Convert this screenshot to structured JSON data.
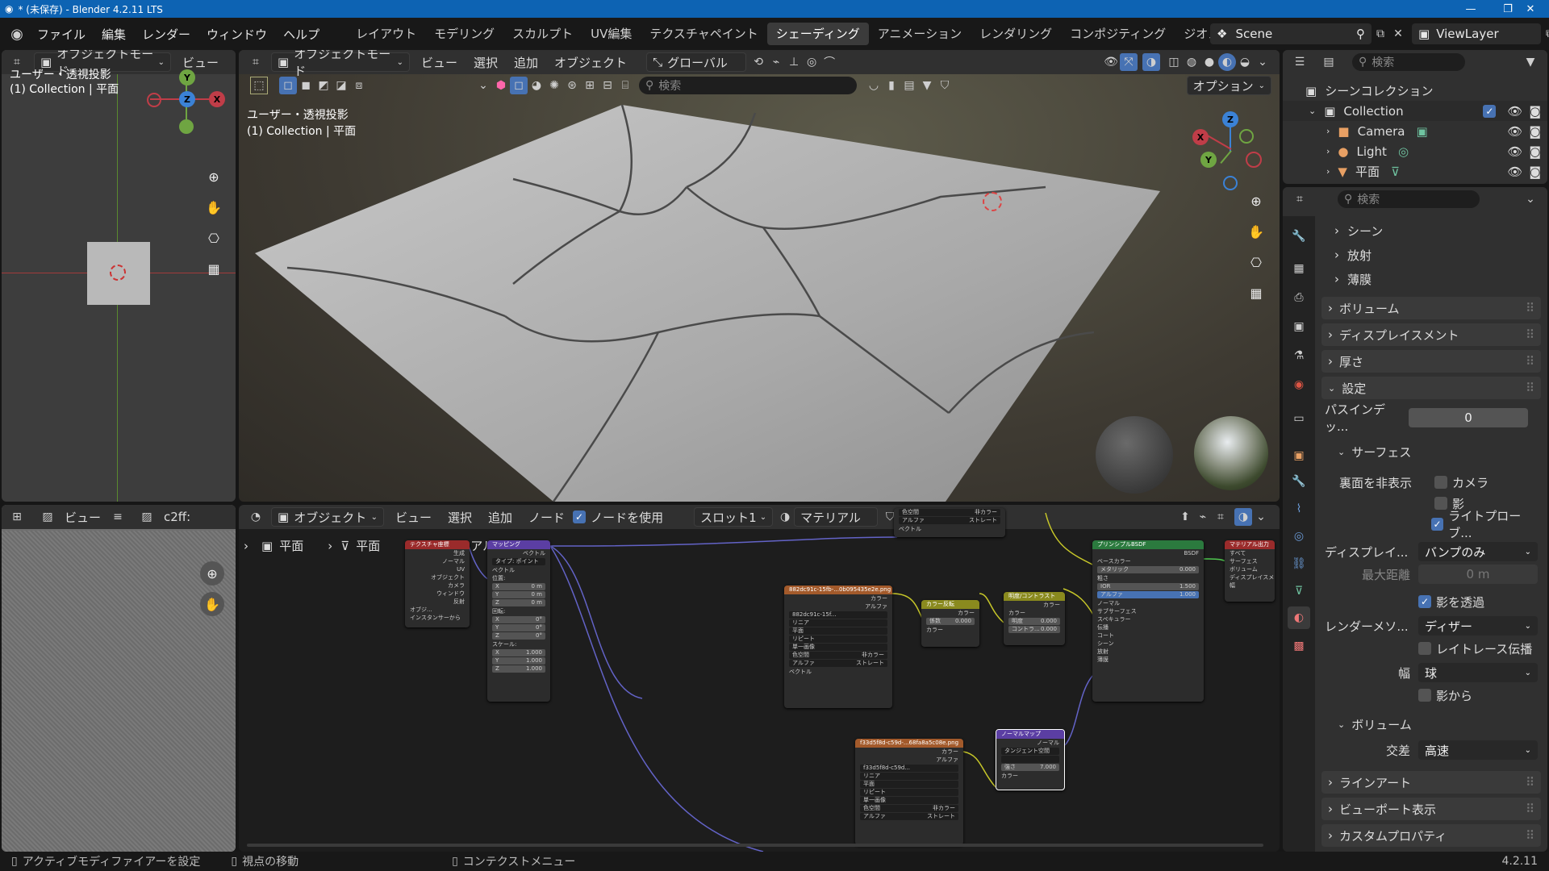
{
  "window": {
    "title": "* (未保存) - Blender 4.2.11 LTS"
  },
  "menubar": {
    "items": [
      "ファイル",
      "編集",
      "レンダー",
      "ウィンドウ",
      "ヘルプ"
    ]
  },
  "workspaces": {
    "tabs": [
      "レイアウト",
      "モデリング",
      "スカルプト",
      "UV編集",
      "テクスチャペイント",
      "シェーディング",
      "アニメーション",
      "レンダリング",
      "コンポジティング",
      "ジオメトリ,"
    ],
    "active": "シェーディング"
  },
  "scene": {
    "name": "Scene",
    "view_layer": "ViewLayer"
  },
  "left_viewport": {
    "mode": "オブジェクトモード",
    "view_menu": "ビュー",
    "overlay_title": "ユーザー・透視投影",
    "overlay_collection": "(1) Collection | 平面",
    "gizmo": {
      "y": "Y",
      "z": "Z",
      "x": "X"
    }
  },
  "image_editor": {
    "view_menu": "ビュー",
    "image_name": "c2ff:"
  },
  "main_viewport": {
    "mode": "オブジェクトモード",
    "menus": [
      "ビュー",
      "選択",
      "追加",
      "オブジェクト"
    ],
    "transform": "グローバル",
    "search_placeholder": "検索",
    "options": "オプション",
    "overlay_title": "ユーザー・透視投影",
    "overlay_collection": "(1) Collection | 平面",
    "gizmo": {
      "x": "X",
      "y": "Y",
      "z": "Z"
    }
  },
  "node_editor": {
    "type": "オブジェクト",
    "menus": [
      "ビュー",
      "選択",
      "追加",
      "ノード"
    ],
    "use_nodes": "ノードを使用",
    "slot": "スロット1",
    "material": "マテリアル",
    "breadcrumb": [
      "平面",
      "平面",
      "マテリアル"
    ],
    "nodes": {
      "texcoord": {
        "title": "テクスチャ座標",
        "rows": [
          "生成",
          "ノーマル",
          "UV",
          "オブジェクト",
          "カメラ",
          "ウィンドウ",
          "反射"
        ],
        "obj": "オブジ...",
        "instancer": "インスタンサーから"
      },
      "mapping": {
        "title": "マッピング",
        "out": "ベクトル",
        "type": "タイプ: ポイント",
        "vec": "ベクトル",
        "loc": "位置:",
        "rot": "回転:",
        "scale": "スケール:",
        "loc_vals": [
          "0 m",
          "0 m",
          "0 m"
        ],
        "rot_vals": [
          "0°",
          "0°",
          "0°"
        ],
        "scale_vals": [
          "1.000",
          "1.000",
          "1.000"
        ],
        "axes": [
          "X",
          "Y",
          "Z"
        ]
      },
      "image1": {
        "title": "882dc91c-15fb-...0b095435e2e.png",
        "out1": "カラー",
        "out2": "アルファ",
        "img": "882dc91c-15f...",
        "interp": "リニア",
        "proj": "平面",
        "ext": "リピート",
        "src": "単一画像",
        "cs_label": "色空間",
        "cs": "非カラー",
        "alpha_label": "アルファ",
        "alpha": "ストレート",
        "vec": "ベクトル"
      },
      "image_top": {
        "r1": "色空間",
        "r1v": "非カラー",
        "r2": "アルファ",
        "r2v": "ストレート",
        "r3": "ベクトル"
      },
      "invert": {
        "title": "カラー反転",
        "out": "カラー",
        "fac": "係数",
        "facv": "0.000",
        "col": "カラー"
      },
      "brightcontrast": {
        "title": "明度/コントラスト",
        "out": "カラー",
        "col": "カラー",
        "b": "明度",
        "bv": "0.000",
        "c": "コントラ...",
        "cv": "0.000"
      },
      "bsdf": {
        "title": "プリンシプルBSDF",
        "out": "BSDF",
        "base": "ベースカラー",
        "metal": "メタリック",
        "metalv": "0.000",
        "rough": "粗さ",
        "ior": "IOR",
        "iorv": "1.500",
        "alpha": "アルファ",
        "alphav": "1.000",
        "normal": "ノーマル",
        "subs": [
          "サブサーフェス",
          "スペキュラー",
          "伝播",
          "コート",
          "シーン",
          "放射",
          "薄膜"
        ]
      },
      "output": {
        "title": "マテリアル出力",
        "target": "すべて",
        "rows": [
          "サーフェス",
          "ボリューム",
          "ディスプレイスメント",
          "幅"
        ]
      },
      "image2": {
        "title": "f33d5f8d-c59d-...68fa8a5c08e.png",
        "out1": "カラー",
        "out2": "アルファ",
        "img": "f33d5f8d-c59d...",
        "interp": "リニア",
        "proj": "平面",
        "ext": "リピート",
        "src": "単一画像",
        "cs_label": "色空間",
        "cs": "非カラー",
        "alpha_label": "アルファ",
        "alpha": "ストレート"
      },
      "normalmap": {
        "title": "ノーマルマップ",
        "out": "ノーマル",
        "space": "タンジェント空間",
        "strength": "強さ",
        "strengthv": "7.000",
        "col": "カラー"
      }
    }
  },
  "outliner": {
    "search_placeholder": "検索",
    "root": "シーンコレクション",
    "collection": "Collection",
    "items": [
      "Camera",
      "Light",
      "平面"
    ]
  },
  "properties": {
    "search_placeholder": "検索",
    "sub": [
      "シーン",
      "放射",
      "薄膜"
    ],
    "panels": {
      "volume": "ボリューム",
      "displacement": "ディスプレイスメント",
      "thickness": "厚さ",
      "settings": "設定"
    },
    "pass_index_label": "パスインデッ...",
    "pass_index": "0",
    "surface": "サーフェス",
    "backface_label": "裏面を非表示",
    "camera": "カメラ",
    "shadow": "影",
    "lightprobe": "ライトプローブ...",
    "displacement_label": "ディスプレイ...",
    "displacement_value": "バンプのみ",
    "maxdist_label": "最大距離",
    "maxdist": "0 m",
    "transparent_shadow": "影を透過",
    "render_method_label": "レンダーメソ...",
    "render_method": "ディザー",
    "raytrace": "レイトレース伝播",
    "width_label": "幅",
    "width_value": "球",
    "from_shadow": "影から",
    "volume2": "ボリューム",
    "intersection_label": "交差",
    "intersection": "高速",
    "lineart": "ラインアート",
    "viewport_display": "ビューポート表示",
    "custom_props": "カスタムプロパティ"
  },
  "statusbar": {
    "items": [
      "アクティブモディファイアーを設定",
      "視点の移動",
      "コンテクストメニュー"
    ],
    "version": "4.2.11"
  }
}
